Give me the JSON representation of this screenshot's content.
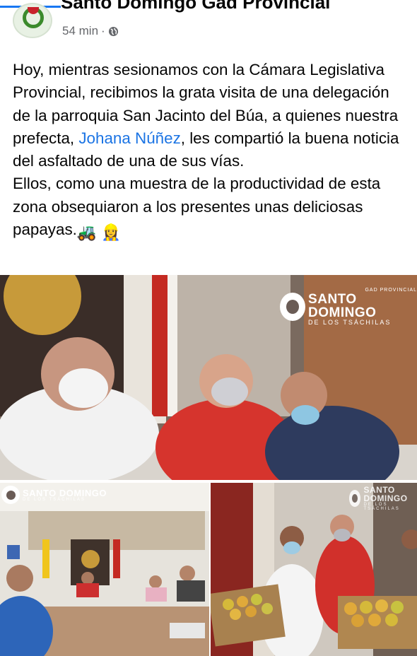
{
  "post": {
    "page_name": "Santo Domingo Gad Provincial",
    "time": "54 min",
    "separator": "·",
    "audience_icon": "globe-icon",
    "paragraph1_before": "Hoy, mientras sesionamos con la Cámara Legislativa Provincial, recibimos la grata visita de una delegación de la parroquia San Jacinto del Búa, a quienes nuestra prefecta, ",
    "mention": "Johana Núñez",
    "paragraph1_after": ", les compartió la buena noticia del asfaltado de una de sus vías.",
    "paragraph2": "Ellos, como una muestra de la productividad de esta zona obsequiaron a los presentes unas deliciosas papayas.",
    "emoji1": "🚜",
    "emoji2": "👷‍♀️"
  },
  "photos": {
    "watermark_top": "GAD PROVINCIAL",
    "watermark_main": "SANTO DOMINGO",
    "watermark_sub": "DE LOS TSÁCHILAS"
  },
  "colors": {
    "mention": "#1b74e4",
    "meta": "#65676b",
    "accent": "#1877f2"
  }
}
